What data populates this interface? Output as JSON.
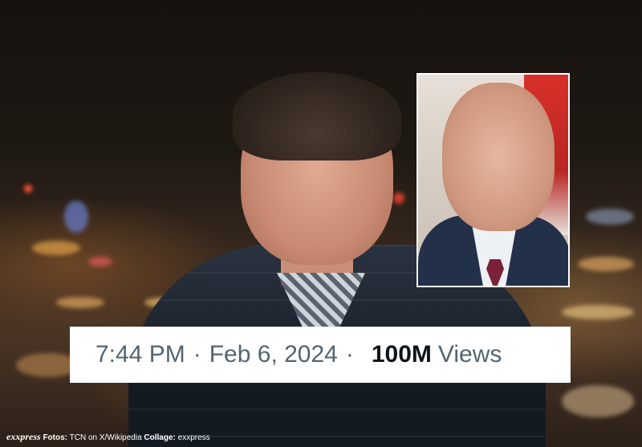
{
  "photo": {
    "scene": "night-city-skyline",
    "inset_border_color": "#ffffff"
  },
  "stats": {
    "time": "7:44 PM",
    "separator": "·",
    "date": "Feb 6, 2024",
    "views_count": "100M",
    "views_label": "Views",
    "text_color": "#536471",
    "count_color": "#0f1419"
  },
  "credit": {
    "brand": "exxpress",
    "fotos_label": "Fotos:",
    "fotos_value": "TCN on X/Wikipedia",
    "collage_label": "Collage:",
    "collage_value": "exxpress"
  }
}
